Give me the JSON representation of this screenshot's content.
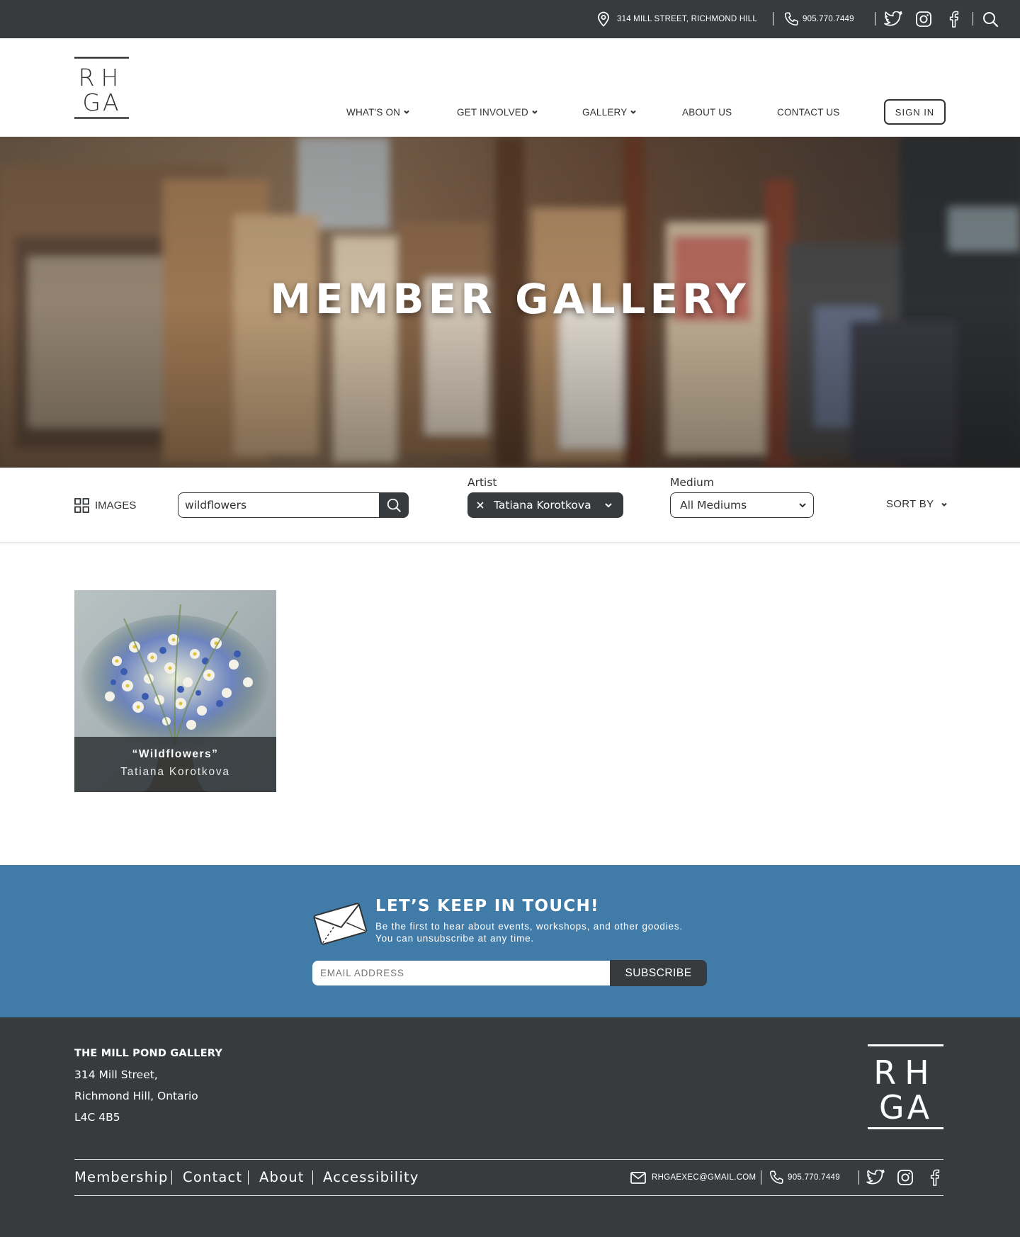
{
  "colors": {
    "topbar": "#373b3e",
    "accent_blue": "#417ca9",
    "text_dark": "#2f3336",
    "white": "#ffffff"
  },
  "topbar": {
    "address": "314 MILL STREET, RICHMOND HILL",
    "phone": "905.770.7449",
    "icons": [
      "location-pin-icon",
      "phone-icon",
      "twitter-icon",
      "instagram-icon",
      "facebook-icon",
      "search-icon"
    ]
  },
  "header": {
    "logo_line1": "RH",
    "logo_line2": "GA",
    "nav": [
      {
        "label": "WHAT'S ON",
        "has_dropdown": true
      },
      {
        "label": "GET INVOLVED",
        "has_dropdown": true
      },
      {
        "label": "GALLERY",
        "has_dropdown": true
      },
      {
        "label": "ABOUT US",
        "has_dropdown": false
      },
      {
        "label": "CONTACT US",
        "has_dropdown": false
      }
    ],
    "sign_in": "SIGN IN"
  },
  "hero": {
    "title": "MEMBER GALLERY"
  },
  "filters": {
    "view_label": "IMAGES",
    "search_value": "wildflowers",
    "artist_label": "Artist",
    "artist_selected": "Tatiana Korotkova",
    "medium_label": "Medium",
    "medium_selected": "All Mediums",
    "sort_label": "SORT BY"
  },
  "gallery": {
    "items": [
      {
        "title": "“Wildflowers”",
        "artist": "Tatiana Korotkova"
      }
    ]
  },
  "newsletter": {
    "title": "LET’S KEEP IN TOUCH!",
    "subtitle_line1": "Be the first to hear about events, workshops, and other goodies.",
    "subtitle_line2": "You can unsubscribe at any time.",
    "email_placeholder": "EMAIL ADDRESS",
    "subscribe": "SUBSCRIBE"
  },
  "footer": {
    "name": "THE MILL POND GALLERY",
    "address_line1": "314 Mill Street,",
    "address_line2": "Richmond Hill, Ontario",
    "postal": "L4C 4B5",
    "links": [
      "Membership",
      "Contact",
      "About",
      "Accessibility"
    ],
    "email": "RHGAEXEC@GMAIL.COM",
    "phone": "905.770.7449",
    "logo_line1": "RH",
    "logo_line2": "GA"
  }
}
